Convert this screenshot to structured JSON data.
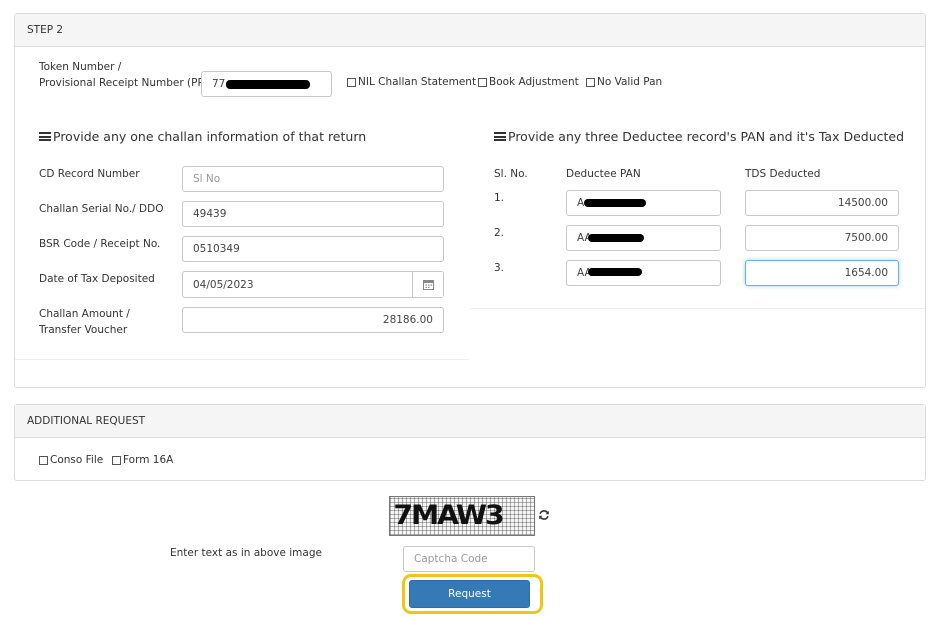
{
  "step2": {
    "header": "STEP 2",
    "token_label_line1": "Token Number /",
    "token_label_line2": "Provisional Receipt Number (PRN)",
    "token_value": "77",
    "checkbox_nil": "NIL Challan Statement",
    "checkbox_book": "Book Adjustment",
    "checkbox_novalid": "No Valid Pan",
    "challan": {
      "title": "Provide any one challan information of that return",
      "cd_record_label": "CD Record Number",
      "cd_record_placeholder": "Sl No",
      "serial_label": "Challan Serial No./ DDO",
      "serial_value": "49439",
      "bsr_label": "BSR Code / Receipt No.",
      "bsr_value": "0510349",
      "date_label": "Date of Tax Deposited",
      "date_value": "04/05/2023",
      "amount_label_line1": "Challan Amount /",
      "amount_label_line2": "Transfer Voucher",
      "amount_value": "28186.00"
    },
    "deductee": {
      "title": "Provide any three Deductee record's PAN and it's Tax Deducted",
      "col_slno": "Sl. No.",
      "col_pan": "Deductee PAN",
      "col_tds": "TDS Deducted",
      "rows": [
        {
          "num": "1.",
          "pan": "A",
          "tds": "14500.00"
        },
        {
          "num": "2.",
          "pan": "AA",
          "tds": "7500.00"
        },
        {
          "num": "3.",
          "pan": "AA",
          "tds": "1654.00"
        }
      ]
    }
  },
  "additional": {
    "header": "ADDITIONAL REQUEST",
    "checkbox_conso": "Conso File",
    "checkbox_form16a": "Form 16A"
  },
  "captcha": {
    "image_text": "7MAW3",
    "instruction": "Enter text as in above image",
    "placeholder": "Captcha Code"
  },
  "request_button": "Request",
  "colors": {
    "primary_button": "#337ab7",
    "highlight_ring": "#f0c419",
    "focus_border": "#66afe9"
  }
}
